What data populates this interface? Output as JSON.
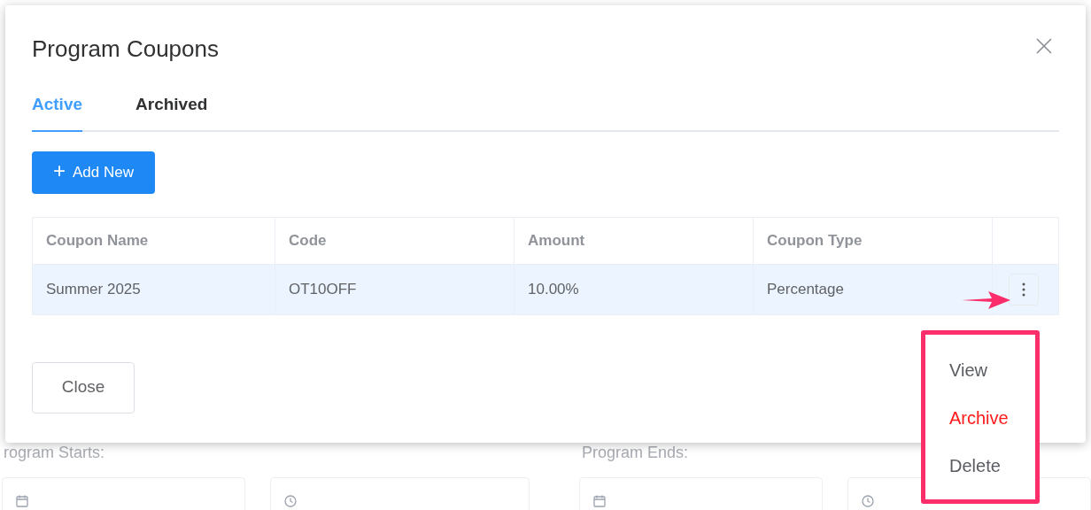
{
  "background": {
    "bottom_labels": [
      "rogram Starts:",
      "Program Ends:"
    ]
  },
  "dialog": {
    "title": "Program Coupons",
    "tabs": [
      {
        "label": "Active",
        "selected": true
      },
      {
        "label": "Archived",
        "selected": false
      }
    ],
    "add_button": {
      "icon": "+",
      "label": "Add New"
    },
    "table": {
      "columns": [
        "Coupon Name",
        "Code",
        "Amount",
        "Coupon Type"
      ],
      "rows": [
        {
          "cells": [
            "Summer 2025",
            "OT10OFF",
            "10.00%",
            "Percentage"
          ],
          "selected": true
        }
      ]
    },
    "close_button": "Close"
  },
  "row_menu": {
    "items": [
      {
        "label": "View",
        "kind": "normal"
      },
      {
        "label": "Archive",
        "kind": "danger"
      },
      {
        "label": "Delete",
        "kind": "normal"
      }
    ]
  }
}
